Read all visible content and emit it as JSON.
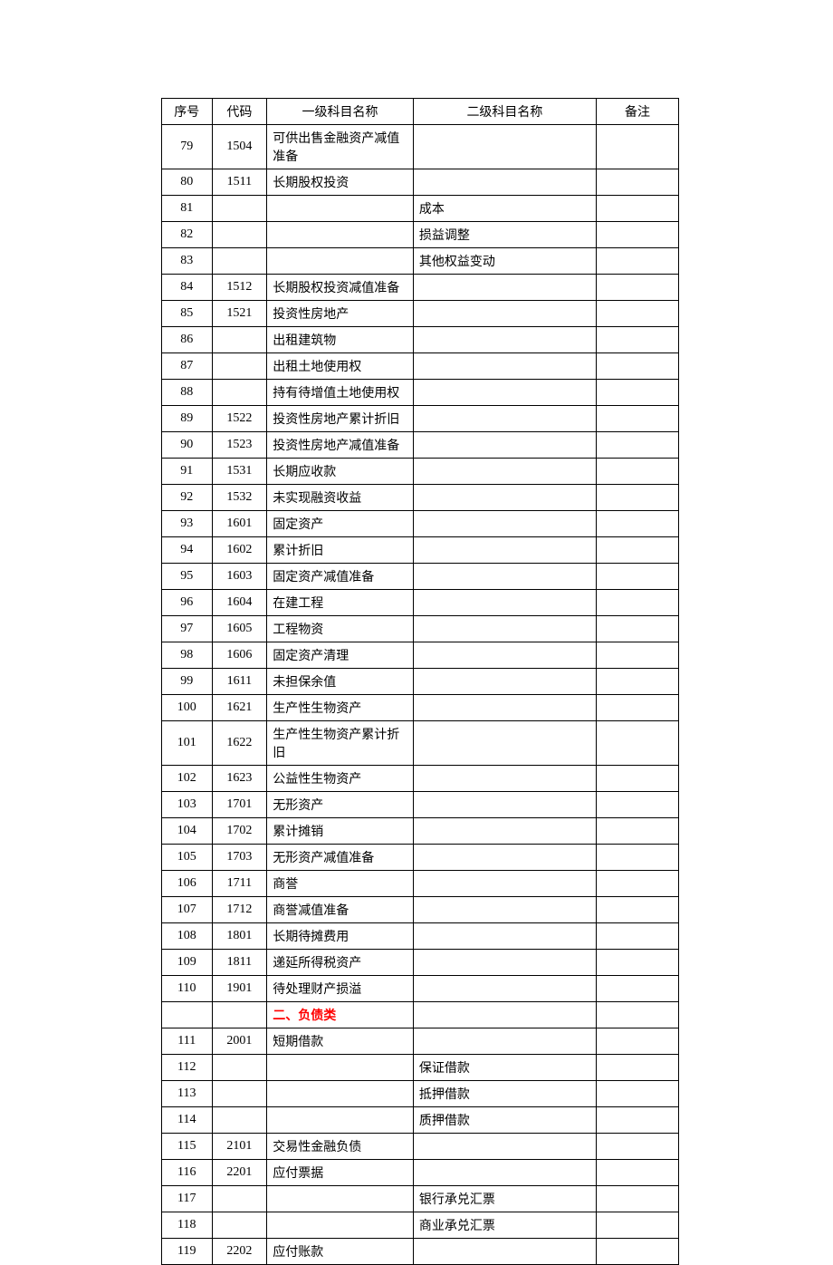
{
  "headers": {
    "seq": "序号",
    "code": "代码",
    "level1": "一级科目名称",
    "level2": "二级科目名称",
    "note": "备注"
  },
  "rows": [
    {
      "seq": "79",
      "code": "1504",
      "level1": "可供出售金融资产减值准备",
      "level2": "",
      "note": ""
    },
    {
      "seq": "80",
      "code": "1511",
      "level1": "长期股权投资",
      "level2": "",
      "note": ""
    },
    {
      "seq": "81",
      "code": "",
      "level1": "",
      "level2": "成本",
      "note": ""
    },
    {
      "seq": "82",
      "code": "",
      "level1": "",
      "level2": "损益调整",
      "note": ""
    },
    {
      "seq": "83",
      "code": "",
      "level1": "",
      "level2": "其他权益变动",
      "note": ""
    },
    {
      "seq": "84",
      "code": "1512",
      "level1": "长期股权投资减值准备",
      "level2": "",
      "note": ""
    },
    {
      "seq": "85",
      "code": "1521",
      "level1": "投资性房地产",
      "level2": "",
      "note": ""
    },
    {
      "seq": "86",
      "code": "",
      "level1": "出租建筑物",
      "level2": "",
      "note": ""
    },
    {
      "seq": "87",
      "code": "",
      "level1": "出租土地使用权",
      "level2": "",
      "note": ""
    },
    {
      "seq": "88",
      "code": "",
      "level1": "持有待增值土地使用权",
      "level2": "",
      "note": ""
    },
    {
      "seq": "89",
      "code": "1522",
      "level1": "投资性房地产累计折旧",
      "level2": "",
      "note": ""
    },
    {
      "seq": "90",
      "code": "1523",
      "level1": "投资性房地产减值准备",
      "level2": "",
      "note": ""
    },
    {
      "seq": "91",
      "code": "1531",
      "level1": "长期应收款",
      "level2": "",
      "note": ""
    },
    {
      "seq": "92",
      "code": "1532",
      "level1": "未实现融资收益",
      "level2": "",
      "note": ""
    },
    {
      "seq": "93",
      "code": "1601",
      "level1": "固定资产",
      "level2": "",
      "note": ""
    },
    {
      "seq": "94",
      "code": "1602",
      "level1": "累计折旧",
      "level2": "",
      "note": ""
    },
    {
      "seq": "95",
      "code": "1603",
      "level1": "固定资产减值准备",
      "level2": "",
      "note": ""
    },
    {
      "seq": "96",
      "code": "1604",
      "level1": "在建工程",
      "level2": "",
      "note": ""
    },
    {
      "seq": "97",
      "code": "1605",
      "level1": "工程物资",
      "level2": "",
      "note": ""
    },
    {
      "seq": "98",
      "code": "1606",
      "level1": "固定资产清理",
      "level2": "",
      "note": ""
    },
    {
      "seq": "99",
      "code": "1611",
      "level1": "未担保余值",
      "level2": "",
      "note": ""
    },
    {
      "seq": "100",
      "code": "1621",
      "level1": "生产性生物资产",
      "level2": "",
      "note": ""
    },
    {
      "seq": "101",
      "code": "1622",
      "level1": "生产性生物资产累计折旧",
      "level2": "",
      "note": ""
    },
    {
      "seq": "102",
      "code": "1623",
      "level1": "公益性生物资产",
      "level2": "",
      "note": ""
    },
    {
      "seq": "103",
      "code": "1701",
      "level1": "无形资产",
      "level2": "",
      "note": ""
    },
    {
      "seq": "104",
      "code": "1702",
      "level1": "累计摊销",
      "level2": "",
      "note": ""
    },
    {
      "seq": "105",
      "code": "1703",
      "level1": "无形资产减值准备",
      "level2": "",
      "note": ""
    },
    {
      "seq": "106",
      "code": "1711",
      "level1": "商誉",
      "level2": "",
      "note": ""
    },
    {
      "seq": "107",
      "code": "1712",
      "level1": "商誉减值准备",
      "level2": "",
      "note": ""
    },
    {
      "seq": "108",
      "code": "1801",
      "level1": "长期待摊费用",
      "level2": "",
      "note": ""
    },
    {
      "seq": "109",
      "code": "1811",
      "level1": "递延所得税资产",
      "level2": "",
      "note": ""
    },
    {
      "seq": "110",
      "code": "1901",
      "level1": "待处理财产损溢",
      "level2": "",
      "note": ""
    },
    {
      "seq": "",
      "code": "",
      "level1": "二、负债类",
      "level2": "",
      "note": "",
      "section": true
    },
    {
      "seq": "111",
      "code": "2001",
      "level1": "短期借款",
      "level2": "",
      "note": ""
    },
    {
      "seq": "112",
      "code": "",
      "level1": "",
      "level2": "保证借款",
      "note": ""
    },
    {
      "seq": "113",
      "code": "",
      "level1": "",
      "level2": "抵押借款",
      "note": ""
    },
    {
      "seq": "114",
      "code": "",
      "level1": "",
      "level2": "质押借款",
      "note": ""
    },
    {
      "seq": "115",
      "code": "2101",
      "level1": "交易性金融负债",
      "level2": "",
      "note": ""
    },
    {
      "seq": "116",
      "code": "2201",
      "level1": "应付票据",
      "level2": "",
      "note": ""
    },
    {
      "seq": "117",
      "code": "",
      "level1": "",
      "level2": "银行承兑汇票",
      "note": ""
    },
    {
      "seq": "118",
      "code": "",
      "level1": "",
      "level2": "商业承兑汇票",
      "note": ""
    },
    {
      "seq": "119",
      "code": "2202",
      "level1": "应付账款",
      "level2": "",
      "note": ""
    }
  ]
}
